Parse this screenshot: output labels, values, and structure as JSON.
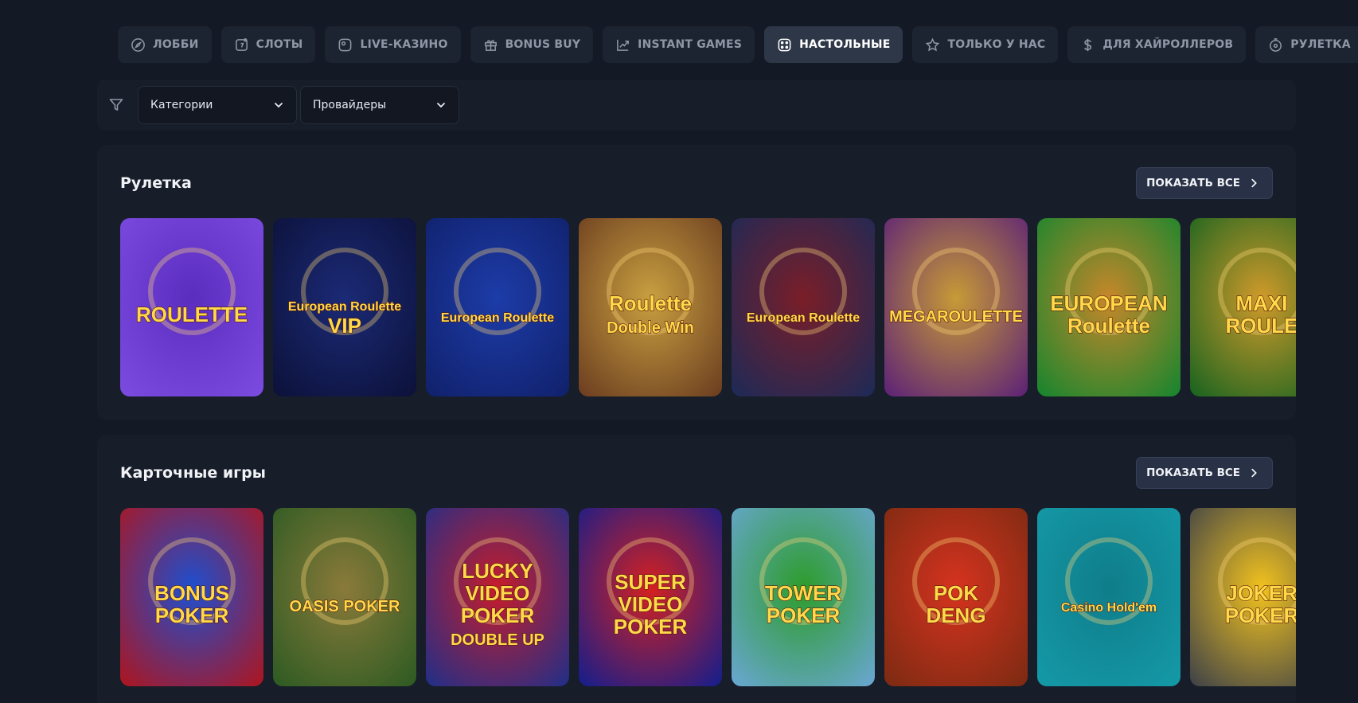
{
  "nav": {
    "items": [
      {
        "label": "ЛОББИ",
        "icon": "compass-icon",
        "active": false
      },
      {
        "label": "СЛОТЫ",
        "icon": "slot-machine-icon",
        "active": false
      },
      {
        "label": "LIVE-КАЗИНО",
        "icon": "camera-icon",
        "active": false
      },
      {
        "label": "BONUS BUY",
        "icon": "gift-icon",
        "active": false
      },
      {
        "label": "INSTANT GAMES",
        "icon": "chart-up-icon",
        "active": false
      },
      {
        "label": "НАСТОЛЬНЫЕ",
        "icon": "dice-icon",
        "active": true
      },
      {
        "label": "ТОЛЬКО У НАС",
        "icon": "star-icon",
        "active": false
      },
      {
        "label": "ДЛЯ ХАЙРОЛЛЕРОВ",
        "icon": "dollar-icon",
        "active": false
      },
      {
        "label": "РУЛЕТКА",
        "icon": "roulette-icon",
        "active": false
      }
    ]
  },
  "filters": {
    "icon": "filter-icon",
    "categories": {
      "value": "Категории",
      "icon": "chevron-down-icon"
    },
    "providers": {
      "value": "Провайдеры",
      "icon": "chevron-down-icon"
    }
  },
  "sections": [
    {
      "title": "Рулетка",
      "show_all": "ПОКАЗАТЬ ВСЕ",
      "games": [
        {
          "title_lines": [
            "ROULETTE"
          ],
          "bg": "#7c4ce0",
          "accent": "#5b2dbf"
        },
        {
          "title_lines": [
            "European Roulette",
            "VIP"
          ],
          "bg": "#0c1138",
          "accent": "#1b2a76"
        },
        {
          "title_lines": [
            "European Roulette"
          ],
          "bg": "#10206a",
          "accent": "#1d3ca8"
        },
        {
          "title_lines": [
            "Roulette",
            "Double Win"
          ],
          "bg": "#6a3b1f",
          "accent": "#c8a040"
        },
        {
          "title_lines": [
            "European Roulette"
          ],
          "bg": "#1b2a58",
          "accent": "#7a1e28"
        },
        {
          "title_lines": [
            "MEGAROULETTE"
          ],
          "bg": "#5a1f78",
          "accent": "#c79a36"
        },
        {
          "title_lines": [
            "EUROPEAN",
            "Roulette"
          ],
          "bg": "#12852e",
          "accent": "#c7872a"
        },
        {
          "title_lines": [
            "MAXI",
            "ROULE"
          ],
          "bg": "#14621f",
          "accent": "#d09a2a"
        }
      ]
    },
    {
      "title": "Карточные игры",
      "show_all": "ПОКАЗАТЬ ВСЕ",
      "games": [
        {
          "title_lines": [
            "BONUS",
            "POKER"
          ],
          "bg": "#b0141b",
          "accent": "#1d4fd0"
        },
        {
          "title_lines": [
            "OASIS POKER"
          ],
          "bg": "#2b5a22",
          "accent": "#8a7a3a"
        },
        {
          "title_lines": [
            "LUCKY",
            "VIDEO",
            "POKER",
            "DOUBLE UP"
          ],
          "bg": "#1d2f8a",
          "accent": "#c81c2a"
        },
        {
          "title_lines": [
            "SUPER",
            "VIDEO",
            "POKER"
          ],
          "bg": "#101e8e",
          "accent": "#d6201f"
        },
        {
          "title_lines": [
            "TOWER",
            "POKER"
          ],
          "bg": "#6aa7d6",
          "accent": "#2d9c2b"
        },
        {
          "title_lines": [
            "POK",
            "DENG"
          ],
          "bg": "#7a2a12",
          "accent": "#d6331f"
        },
        {
          "title_lines": [
            "Casino Hold'em"
          ],
          "bg": "#159aa8",
          "accent": "#0f7d8a"
        },
        {
          "title_lines": [
            "JOKER",
            "POKER"
          ],
          "bg": "#3a3f48",
          "accent": "#f2c21e"
        }
      ]
    }
  ]
}
